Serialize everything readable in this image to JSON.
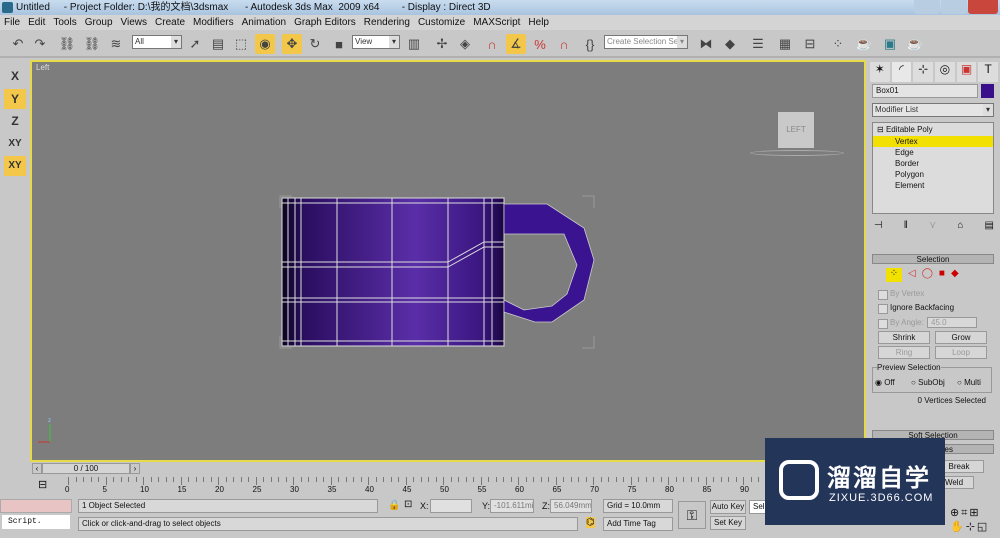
{
  "window": {
    "title": "Untitled     - Project Folder: D:\\我的文档\\3dsmax      - Autodesk 3ds Max  2009 x64        - Display : Direct 3D"
  },
  "menu": [
    "File",
    "Edit",
    "Tools",
    "Group",
    "Views",
    "Create",
    "Modifiers",
    "Animation",
    "Graph Editors",
    "Rendering",
    "Customize",
    "MAXScript",
    "Help"
  ],
  "toolbar": {
    "selection_filter": "All",
    "reference_coord": "View",
    "named_selection_placeholder": "Create Selection Set",
    "active_tools": [
      "select-and-move",
      "select-region",
      "angle-snap"
    ]
  },
  "axis_constraints": [
    "X",
    "Y",
    "Z",
    "XY",
    "XY"
  ],
  "viewport": {
    "label": "Left",
    "viewcube_label": "LEFT",
    "object_color": "#4b1f9a",
    "border_color": "#e6d94a",
    "background": "#7d7d7d"
  },
  "command_panel": {
    "object_name": "Box01",
    "object_color": "#3a0f8c",
    "modifier_list": "Modifier List",
    "stack": {
      "root": "Editable Poly",
      "items": [
        "Vertex",
        "Edge",
        "Border",
        "Polygon",
        "Element"
      ],
      "selected": "Vertex"
    },
    "selection": {
      "header": "Selection",
      "by_vertex": "By Vertex",
      "ignore_backfacing": "Ignore Backfacing",
      "by_angle": "By Angle:",
      "angle_value": "45.0",
      "shrink": "Shrink",
      "grow": "Grow",
      "ring": "Ring",
      "loop": "Loop",
      "preview_title": "Preview Selection",
      "preview_options": [
        "Off",
        "SubObj",
        "Multi"
      ],
      "preview_selected": "Off",
      "status": "0 Vertices Selected"
    },
    "soft_selection": "Soft Selection",
    "edit_vertices": "es",
    "break": "Break",
    "weld": "Weld"
  },
  "timeline": {
    "frame": "0 / 100",
    "ticks": [
      "0",
      "5",
      "10",
      "15",
      "20",
      "25",
      "30",
      "35",
      "40",
      "45",
      "50",
      "55",
      "60",
      "65",
      "70",
      "75",
      "80",
      "85",
      "90"
    ]
  },
  "status": {
    "script": "Script.",
    "selection": "1 Object Selected",
    "prompt": "Click or click-and-drag to select objects",
    "x_label": "X:",
    "x_value": "",
    "y_label": "Y:",
    "y_value": "-101.611mi",
    "z_label": "Z:",
    "z_value": "56.049mm",
    "grid": "Grid = 10.0mm",
    "add_time_tag": "Add Time Tag",
    "auto_key": "Auto Key",
    "set_key": "Set Key",
    "key_filter": "Sele"
  },
  "watermark": {
    "brand": "溜溜自学",
    "url": "ZIXUE.3D66.COM"
  }
}
